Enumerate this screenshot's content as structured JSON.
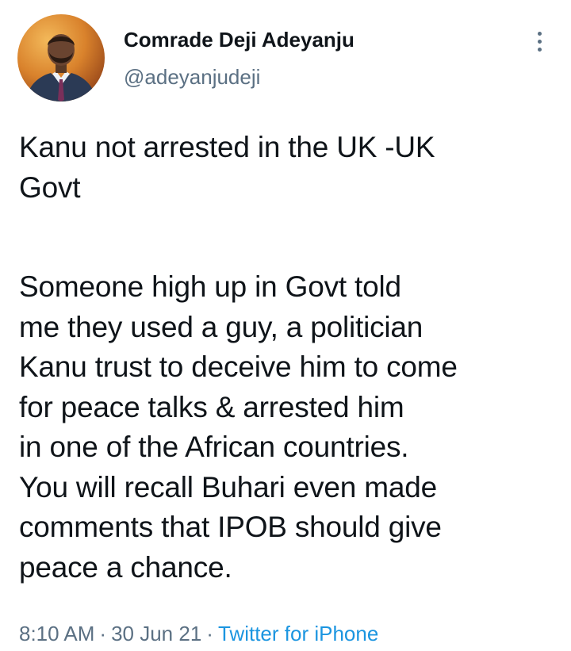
{
  "author": {
    "display_name": "Comrade Deji Adeyanju",
    "handle": "@adeyanjudeji",
    "avatar_icon": "profile-photo"
  },
  "more_icon": "vertical-ellipsis-icon",
  "tweet": {
    "paragraph_1": [
      "Kanu not arrested in the UK -UK",
      "Govt"
    ],
    "paragraph_2": [
      "Someone high up in Govt told",
      "me they used a guy, a politician",
      "Kanu trust to deceive him to come",
      "for peace talks & arrested him",
      "in one of the African countries.",
      "You will recall Buhari even made",
      "comments that IPOB should give",
      "peace a chance."
    ]
  },
  "meta": {
    "time": "8:10 AM",
    "date": "30 Jun 21",
    "separator": "·",
    "source": "Twitter for iPhone"
  },
  "colors": {
    "text_primary": "#0f1419",
    "text_secondary": "#5b7083",
    "link": "#1b95e0",
    "background": "#ffffff"
  }
}
